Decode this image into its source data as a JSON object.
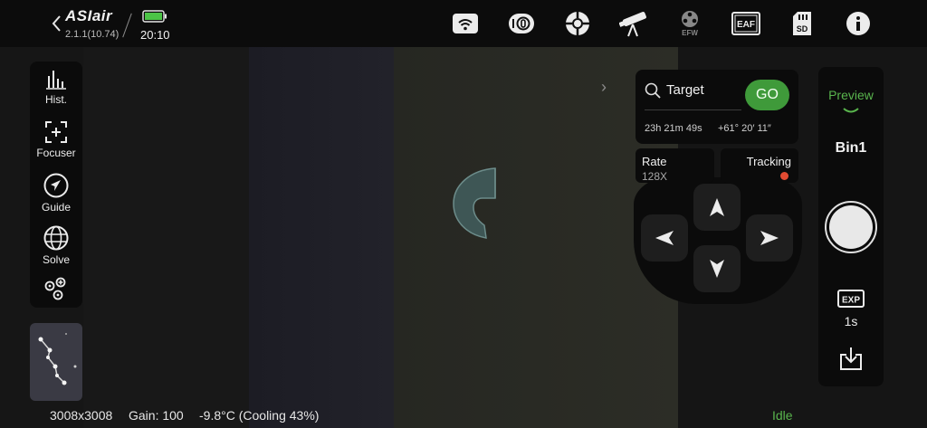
{
  "app": {
    "brand": "ASIair",
    "version": "2.1.1(10.74)",
    "time": "20:10"
  },
  "toolbar": {
    "icons": [
      "wifi-icon",
      "camera-icon",
      "guide-scope-icon",
      "telescope-icon",
      "efw-icon",
      "eaf-icon",
      "sd-card-icon",
      "info-icon"
    ],
    "efw_label": "EFW",
    "eaf_label": "EAF",
    "sd_label": "SD"
  },
  "sidebar": {
    "items": [
      {
        "label": "Hist.",
        "icon": "histogram-icon"
      },
      {
        "label": "Focuser",
        "icon": "focuser-icon"
      },
      {
        "label": "Guide",
        "icon": "guide-icon"
      },
      {
        "label": "Solve",
        "icon": "solve-icon"
      },
      {
        "label": "",
        "icon": "more-icon"
      }
    ]
  },
  "target": {
    "placeholder": "Target",
    "go_label": "GO",
    "ra": "23h 21m 49s",
    "dec": "+61° 20′ 11″"
  },
  "mount": {
    "rate_label": "Rate",
    "rate_value": "128X",
    "tracking_label": "Tracking",
    "tracking_status_color": "#e24b32"
  },
  "camera": {
    "mode_label": "Preview",
    "bin_label": "Bin1",
    "exp_label": "EXP",
    "exposure": "1s"
  },
  "status": {
    "resolution": "3008x3008",
    "gain": "Gain: 100",
    "temperature": "-9.8°C (Cooling 43%)",
    "state": "Idle"
  },
  "colors": {
    "accent_green": "#3f9a3a",
    "status_green": "#59b54d",
    "tracking_red": "#e24b32"
  }
}
